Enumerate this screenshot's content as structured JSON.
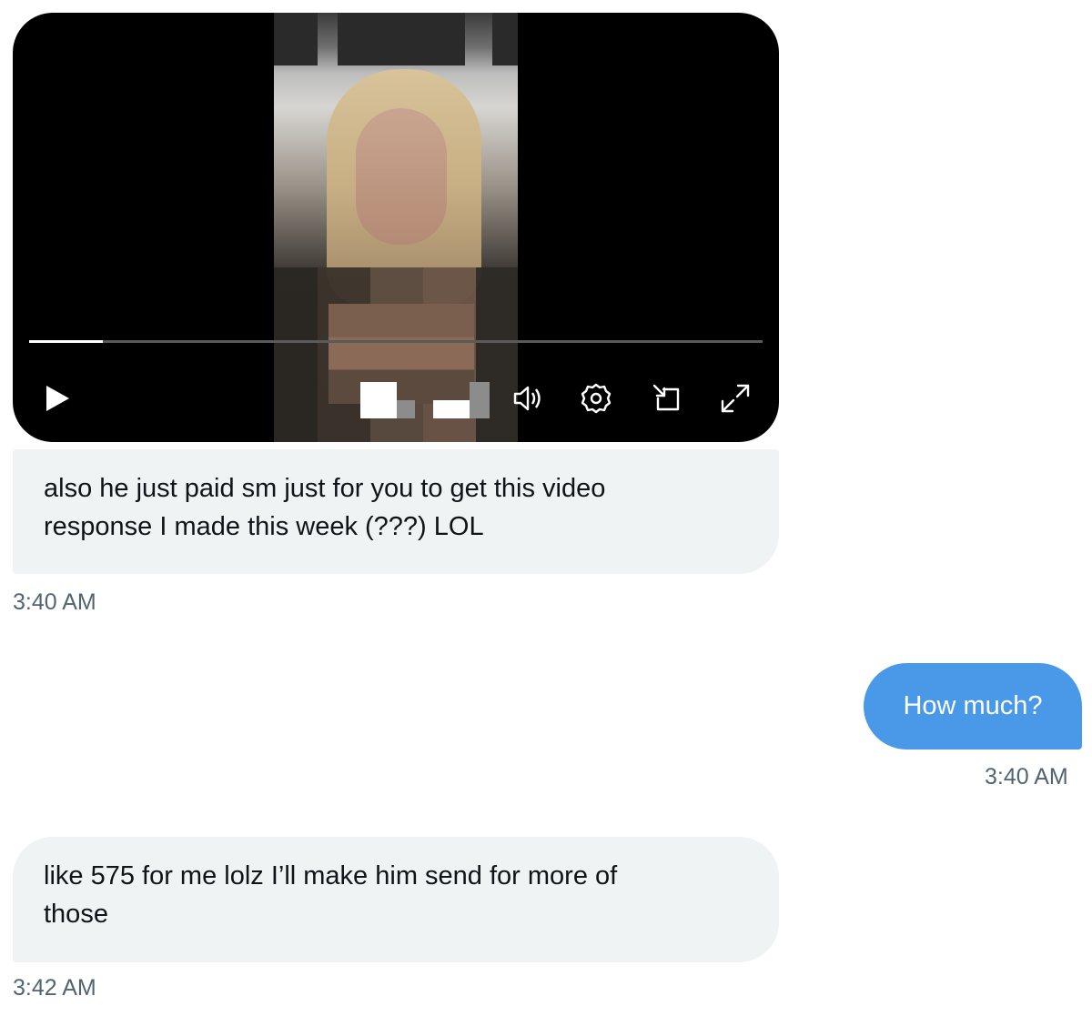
{
  "conversation": {
    "video_message": {
      "progress_fraction": 0.1,
      "controls": {
        "play_icon": "play-icon",
        "volume_icon": "volume-icon",
        "settings_icon": "settings-icon",
        "pip_icon": "picture-in-picture-icon",
        "fullscreen_icon": "fullscreen-icon"
      }
    },
    "messages": [
      {
        "direction": "incoming",
        "text": "also he just paid sm just for you to get this video response I made this week (???) LOL",
        "line1": "also he just paid sm just for you to get this video",
        "line2": "response I made this week (???) LOL",
        "time": "3:40 AM"
      },
      {
        "direction": "outgoing",
        "text": "How much?",
        "time": "3:40 AM"
      },
      {
        "direction": "incoming",
        "text": "like 575 for me lolz I’ll make him send for more of those",
        "line1": "like 575 for me lolz I’ll make him send for more of",
        "line2": "those",
        "time": "3:42 AM"
      }
    ]
  },
  "colors": {
    "incoming_bubble": "#eff3f4",
    "outgoing_bubble": "#4a99e9",
    "timestamp": "#536471",
    "text": "#0f1419"
  }
}
